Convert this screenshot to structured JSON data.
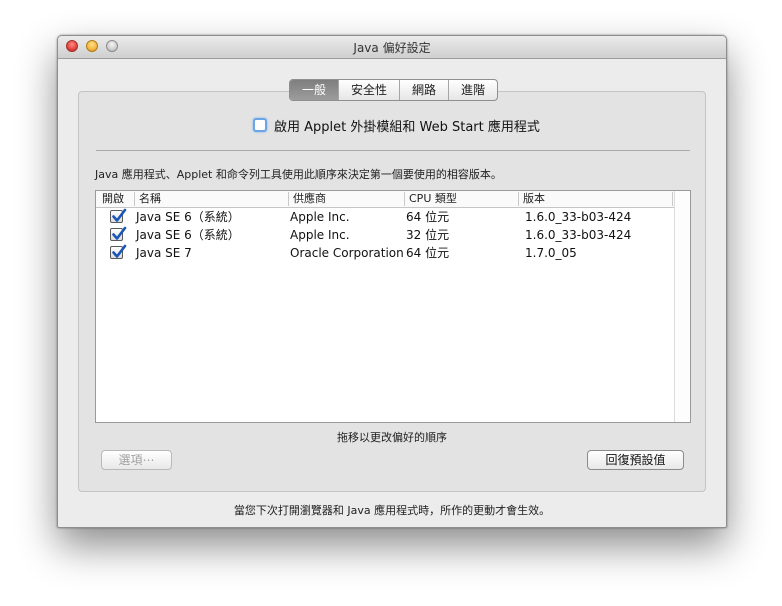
{
  "window": {
    "title": "Java 偏好設定"
  },
  "tabs": [
    {
      "label": "一般",
      "selected": true
    },
    {
      "label": "安全性",
      "selected": false
    },
    {
      "label": "網路",
      "selected": false
    },
    {
      "label": "進階",
      "selected": false
    }
  ],
  "enable_option": {
    "label": "啟用 Applet 外掛模組和 Web Start 應用程式",
    "checked": false
  },
  "description": "Java 應用程式、Applet 和命令列工具使用此順序來決定第一個要使用的相容版本。",
  "table": {
    "headers": [
      "開啟",
      "名稱",
      "供應商",
      "CPU 類型",
      "版本"
    ],
    "rows": [
      {
        "enabled": true,
        "name": "Java SE 6（系統）",
        "vendor": "Apple Inc.",
        "cpu": "64 位元",
        "version": "1.6.0_33-b03-424"
      },
      {
        "enabled": true,
        "name": "Java SE 6（系統）",
        "vendor": "Apple Inc.",
        "cpu": "32 位元",
        "version": "1.6.0_33-b03-424"
      },
      {
        "enabled": true,
        "name": "Java SE 7",
        "vendor": "Oracle Corporation",
        "cpu": "64 位元",
        "version": "1.7.0_05"
      }
    ]
  },
  "drag_hint": "拖移以更改偏好的順序",
  "buttons": {
    "options": "選項⋯",
    "restore_defaults": "回復預設值"
  },
  "footer_note": "當您下次打開瀏覽器和 Java 應用程式時，所作的更動才會生效。",
  "colors": {
    "checkbox_check": "#1a56b8",
    "selected_tab": "#8a8a8a",
    "focus_ring": "#6aa5e6"
  }
}
